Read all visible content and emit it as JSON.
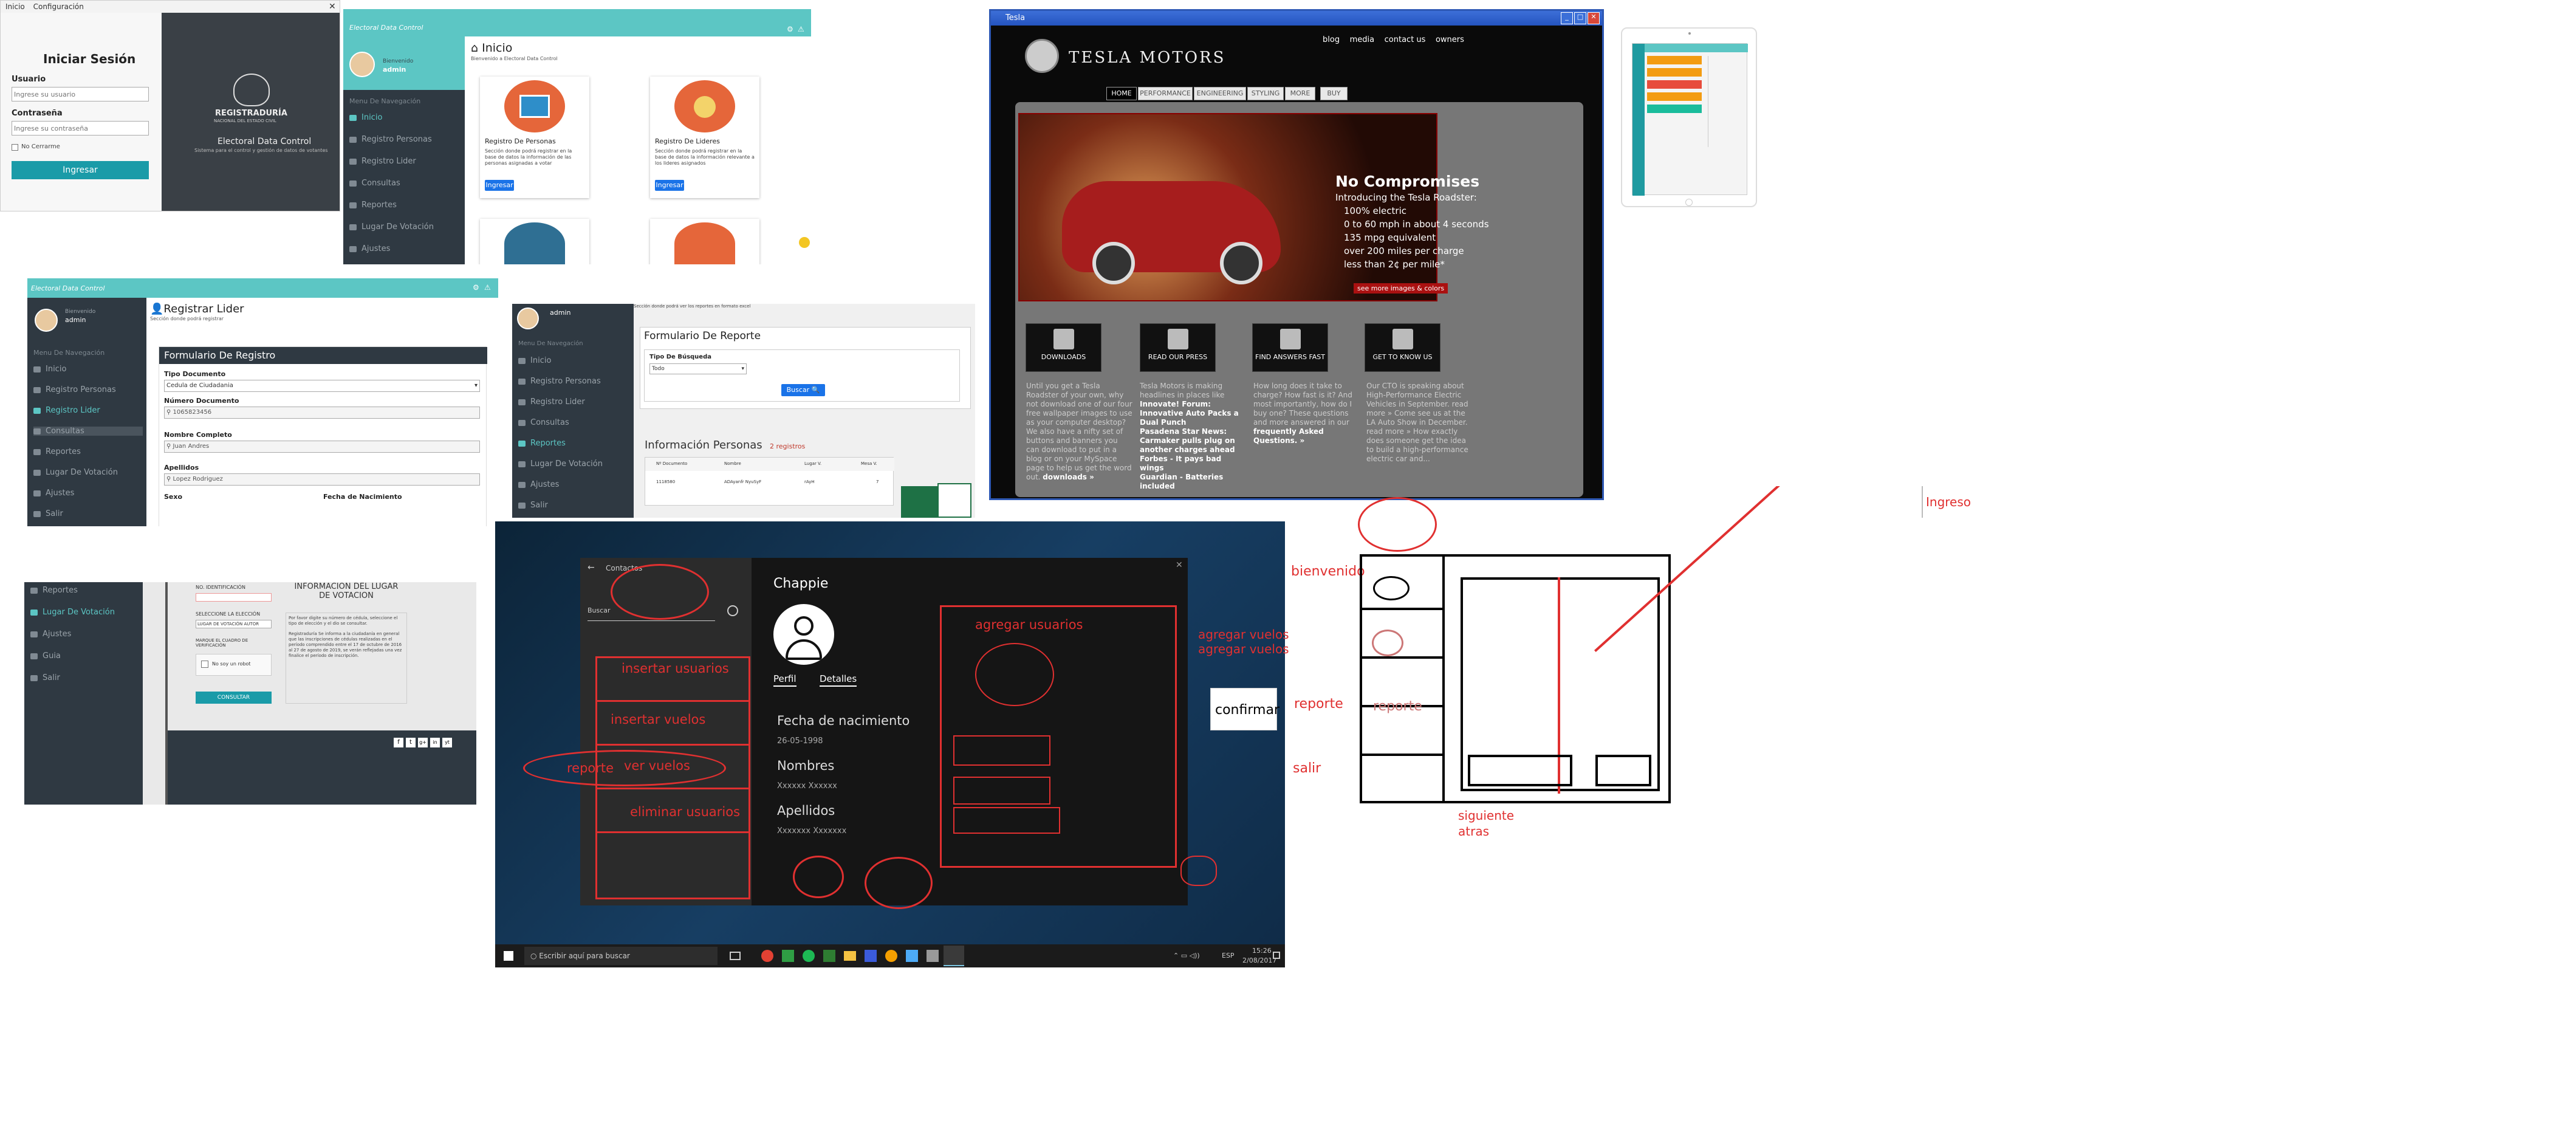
{
  "login": {
    "menu": [
      "Inicio",
      "Configuración"
    ],
    "title": "Iniciar Sesión",
    "user_label": "Usuario",
    "user_placeholder": "Ingrese su usuario",
    "pass_label": "Contraseña",
    "pass_placeholder": "Ingrese su contraseña",
    "remember": "No Cerrarme",
    "submit": "Ingresar",
    "brand": "REGISTRADURÍA",
    "brand_sub": "NACIONAL DEL ESTADO CIVIL",
    "app_name": "Electoral Data Control",
    "app_desc": "Sistema para el control y gestión de datos de votantes"
  },
  "dash": {
    "app_title": "Electoral Data Control",
    "user_greeting": "Bienvenido",
    "user_name": "admin",
    "menu_header": "Menu De Navegación",
    "menu": [
      "Inicio",
      "Registro Personas",
      "Registro Lider",
      "Consultas",
      "Reportes",
      "Lugar De Votación",
      "Ajustes",
      "Salir"
    ],
    "page_title": "Inicio",
    "page_sub": "Bienvenido a Electoral Data Control",
    "cards": [
      {
        "title": "Registro De Personas",
        "desc": "Sección donde podrá registrar en la base de datos la información de las personas asignadas a votar",
        "btn": "Ingresar"
      },
      {
        "title": "Registro De Lideres",
        "desc": "Sección donde podrá registrar en la base de datos la información relevante a los lideres asignados",
        "btn": "Ingresar"
      }
    ]
  },
  "lider": {
    "page_title": "Registrar Lider",
    "page_sub": "Sección donde podrá registrar",
    "form_title": "Formulario De Registro",
    "doc_type_label": "Tipo Documento",
    "doc_type_value": "Cedula de Ciudadania",
    "doc_num_label": "Número Documento",
    "doc_num_value": "1065823456",
    "name_label": "Nombre Completo",
    "name_value": "Juan Andres",
    "last_label": "Apellidos",
    "last_value": "Lopez Rodriguez",
    "sex_label": "Sexo",
    "birth_label": "Fecha de Nacimiento"
  },
  "reporte": {
    "page_sub": "Sección donde podrá ver los reportes en formato excel",
    "form_title": "Formulario De Reporte",
    "search_type_label": "Tipo De Búsqueda",
    "search_type_value": "Todo",
    "search_btn": "Buscar",
    "info_title": "Información Personas",
    "records": "2 registros",
    "cols": [
      "Nº Documento",
      "Nombre",
      "Lugar V.",
      "Mesa V."
    ],
    "row": [
      "1118580",
      "ADAyanfr NyuSyF",
      "rAyH",
      "7"
    ]
  },
  "lugar": {
    "menu": [
      "Reportes",
      "Lugar De Votación",
      "Ajustes",
      "Guia",
      "Salir"
    ],
    "id_label": "NO. IDENTIFICACIÓN",
    "select_label": "SELECCIONE LA ELECCIÓN",
    "select_value": "LUGAR DE VOTACIÓN AUTOR",
    "verify_label": "MARQUE EL CUADRO DE VERIFICACIÓN",
    "robot": "No soy un robot",
    "consult_btn": "CONSULTAR",
    "info_title": "INFORMACIÓN DEL LUGAR DE VOTACION",
    "info_text1": "Por favor digite su número de cédula, seleccione el tipo de elección y el dio se consultar.",
    "info_text2": "Registraduría Se informa a la ciudadanía en general que las inscripciones de cédulas realizadas en el período comprendido entre el 17 de octubre de 2016 al 27 de agosto de 2019, se verán reflejadas una vez finalice el período de inscripción.",
    "social": [
      "f",
      "t",
      "g+",
      "in",
      "yt"
    ]
  },
  "mock": {
    "back_label": "Contactos",
    "search_placeholder": "Buscar",
    "contact_name": "Chappie",
    "tabs": [
      "Perfil",
      "Detalles"
    ],
    "birth_label": "Fecha de nacimiento",
    "birth_value": "26-05-1998",
    "names_label": "Nombres",
    "names_value": "Xxxxxx Xxxxxx",
    "last_label": "Apellidos",
    "last_value": "Xxxxxxx Xxxxxxx",
    "annotations": [
      "insertar usuarios",
      "insertar vuelos",
      "ver vuelos",
      "eliminar usuarios",
      "reporte",
      "agregar usuarios"
    ]
  },
  "taskbar": {
    "search": "Escribir aquí para buscar",
    "lang": "ESP",
    "time": "15:26",
    "date": "2/08/2017"
  },
  "tesla": {
    "window_title": "Tesla",
    "logo": "TESLA MOTORS",
    "top_links": [
      "blog",
      "media",
      "contact us",
      "owners"
    ],
    "nav": [
      "HOME",
      "PERFORMANCE",
      "ENGINEERING",
      "STYLING",
      "MORE",
      "BUY"
    ],
    "hero_title": "No Compromises",
    "hero_sub": "Introducing the Tesla Roadster:",
    "features": [
      "100% electric",
      "0 to 60 mph in about 4 seconds",
      "135 mpg equivalent",
      "over 200 miles per charge",
      "less than 2¢ per mile*"
    ],
    "more_link": "see more images & colors",
    "tiles": [
      "DOWNLOADS",
      "READ OUR PRESS",
      "FIND ANSWERS FAST",
      "GET TO KNOW US"
    ],
    "col1": "Until you get a Tesla Roadster of your own, why not download one of our four free wallpaper images to use as your computer desktop? We also have a nifty set of buttons and banners you can download to put in a blog or on your MySpace page to help us get the word out.",
    "col1_link": "downloads »",
    "col2": "Tesla Motors is making headlines in places like",
    "col2_items": [
      "Innovate! Forum: Innovative Auto Packs a Dual Punch",
      "Pasadena Star News: Carmaker pulls plug on another charges ahead",
      "Forbes - It pays bad wings",
      "Guardian - Batteries included"
    ],
    "col3": "How long does it take to charge? How fast is it? And most importantly, how do I buy one? These questions and more answered in our",
    "col3_link": "frequently Asked Questions. »",
    "col4": "Our CTO is speaking about High-Performance Electric Vehicles in September. read more » Come see us at the LA Auto Show in December. read more » How exactly does someone get the idea to build a high-performance electric car and..."
  },
  "sketch": {
    "labels": [
      "bienvenido",
      "agregar vuelos agregar vuelos",
      "confirmar",
      "reporte",
      "reporte",
      "salir",
      "siguiente",
      "atras",
      "Ingreso"
    ]
  }
}
